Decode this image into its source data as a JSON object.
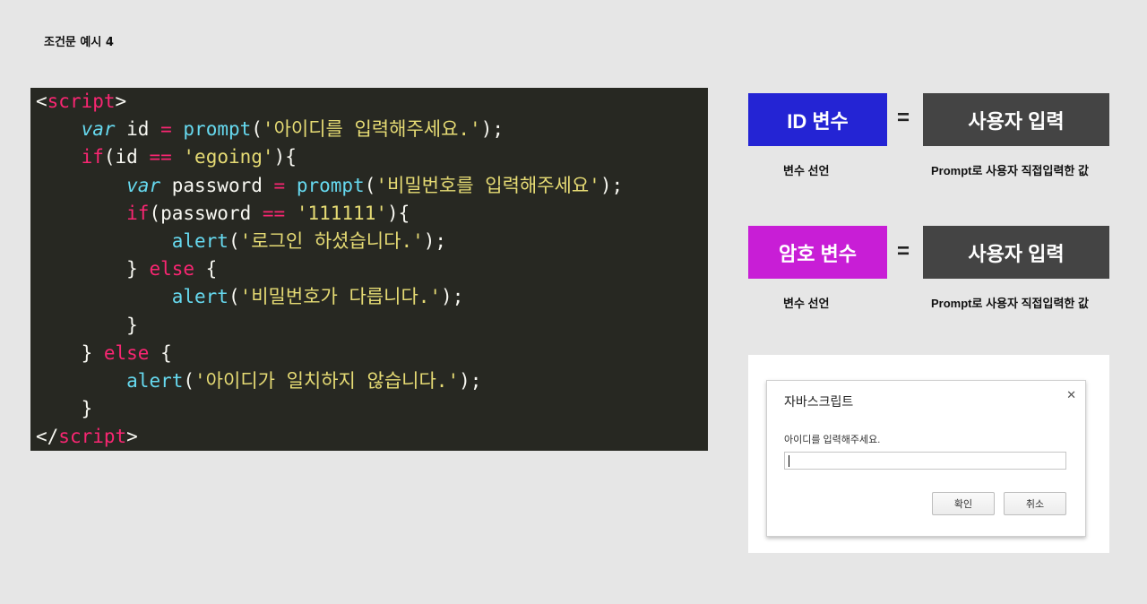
{
  "page": {
    "title": "조건문 예시 4"
  },
  "code": {
    "lines": [
      [
        [
          "tag",
          "<"
        ],
        [
          "tagname",
          "script"
        ],
        [
          "tag",
          ">"
        ]
      ],
      [
        [
          "sp",
          "    "
        ],
        [
          "kw",
          "var"
        ],
        [
          "id",
          " id "
        ],
        [
          "op",
          "="
        ],
        [
          "id",
          " "
        ],
        [
          "fn",
          "prompt"
        ],
        [
          "id",
          "("
        ],
        [
          "str",
          "'아이디를 입력해주세요.'"
        ],
        [
          "id",
          ");"
        ]
      ],
      [
        [
          "sp",
          "    "
        ],
        [
          "ctrl",
          "if"
        ],
        [
          "id",
          "(id "
        ],
        [
          "op",
          "=="
        ],
        [
          "id",
          " "
        ],
        [
          "str",
          "'egoing'"
        ],
        [
          "id",
          "){"
        ]
      ],
      [
        [
          "sp",
          "        "
        ],
        [
          "kw",
          "var"
        ],
        [
          "id",
          " password "
        ],
        [
          "op",
          "="
        ],
        [
          "id",
          " "
        ],
        [
          "fn",
          "prompt"
        ],
        [
          "id",
          "("
        ],
        [
          "str",
          "'비밀번호를 입력해주세요'"
        ],
        [
          "id",
          ");"
        ]
      ],
      [
        [
          "sp",
          "        "
        ],
        [
          "ctrl",
          "if"
        ],
        [
          "id",
          "(password "
        ],
        [
          "op",
          "=="
        ],
        [
          "id",
          " "
        ],
        [
          "str",
          "'111111'"
        ],
        [
          "id",
          "){"
        ]
      ],
      [
        [
          "sp",
          "            "
        ],
        [
          "fn",
          "alert"
        ],
        [
          "id",
          "("
        ],
        [
          "str",
          "'로그인 하셨습니다.'"
        ],
        [
          "id",
          ");"
        ]
      ],
      [
        [
          "sp",
          "        "
        ],
        [
          "id",
          "} "
        ],
        [
          "ctrl",
          "else"
        ],
        [
          "id",
          " {"
        ]
      ],
      [
        [
          "sp",
          "            "
        ],
        [
          "fn",
          "alert"
        ],
        [
          "id",
          "("
        ],
        [
          "str",
          "'비밀번호가 다릅니다.'"
        ],
        [
          "id",
          ");"
        ]
      ],
      [
        [
          "sp",
          "        "
        ],
        [
          "id",
          "}"
        ]
      ],
      [
        [
          "sp",
          "    "
        ],
        [
          "id",
          "} "
        ],
        [
          "ctrl",
          "else"
        ],
        [
          "id",
          " {"
        ]
      ],
      [
        [
          "sp",
          "        "
        ],
        [
          "fn",
          "alert"
        ],
        [
          "id",
          "("
        ],
        [
          "str",
          "'아이디가 일치하지 않습니다.'"
        ],
        [
          "id",
          ");"
        ]
      ],
      [
        [
          "sp",
          "    "
        ],
        [
          "id",
          "}"
        ]
      ],
      [
        [
          "tag",
          "</"
        ],
        [
          "tagname",
          "script"
        ],
        [
          "tag",
          ">"
        ]
      ]
    ]
  },
  "diagram": {
    "row1": {
      "left_label": "ID 변수",
      "equals": "=",
      "right_label": "사용자 입력",
      "left_caption": "변수 선언",
      "right_caption": "Prompt로 사용자 직접입력한 값",
      "left_color": "#2424d4"
    },
    "row2": {
      "left_label": "암호 변수",
      "equals": "=",
      "right_label": "사용자 입력",
      "left_caption": "변수 선언",
      "right_caption": "Prompt로 사용자 직접입력한 값",
      "left_color": "#c81ed6"
    }
  },
  "dialog": {
    "title": "자바스크립트",
    "close_icon": "close-icon",
    "message": "아이디를 입력해주세요.",
    "input_value": "",
    "ok_label": "확인",
    "cancel_label": "취소"
  }
}
